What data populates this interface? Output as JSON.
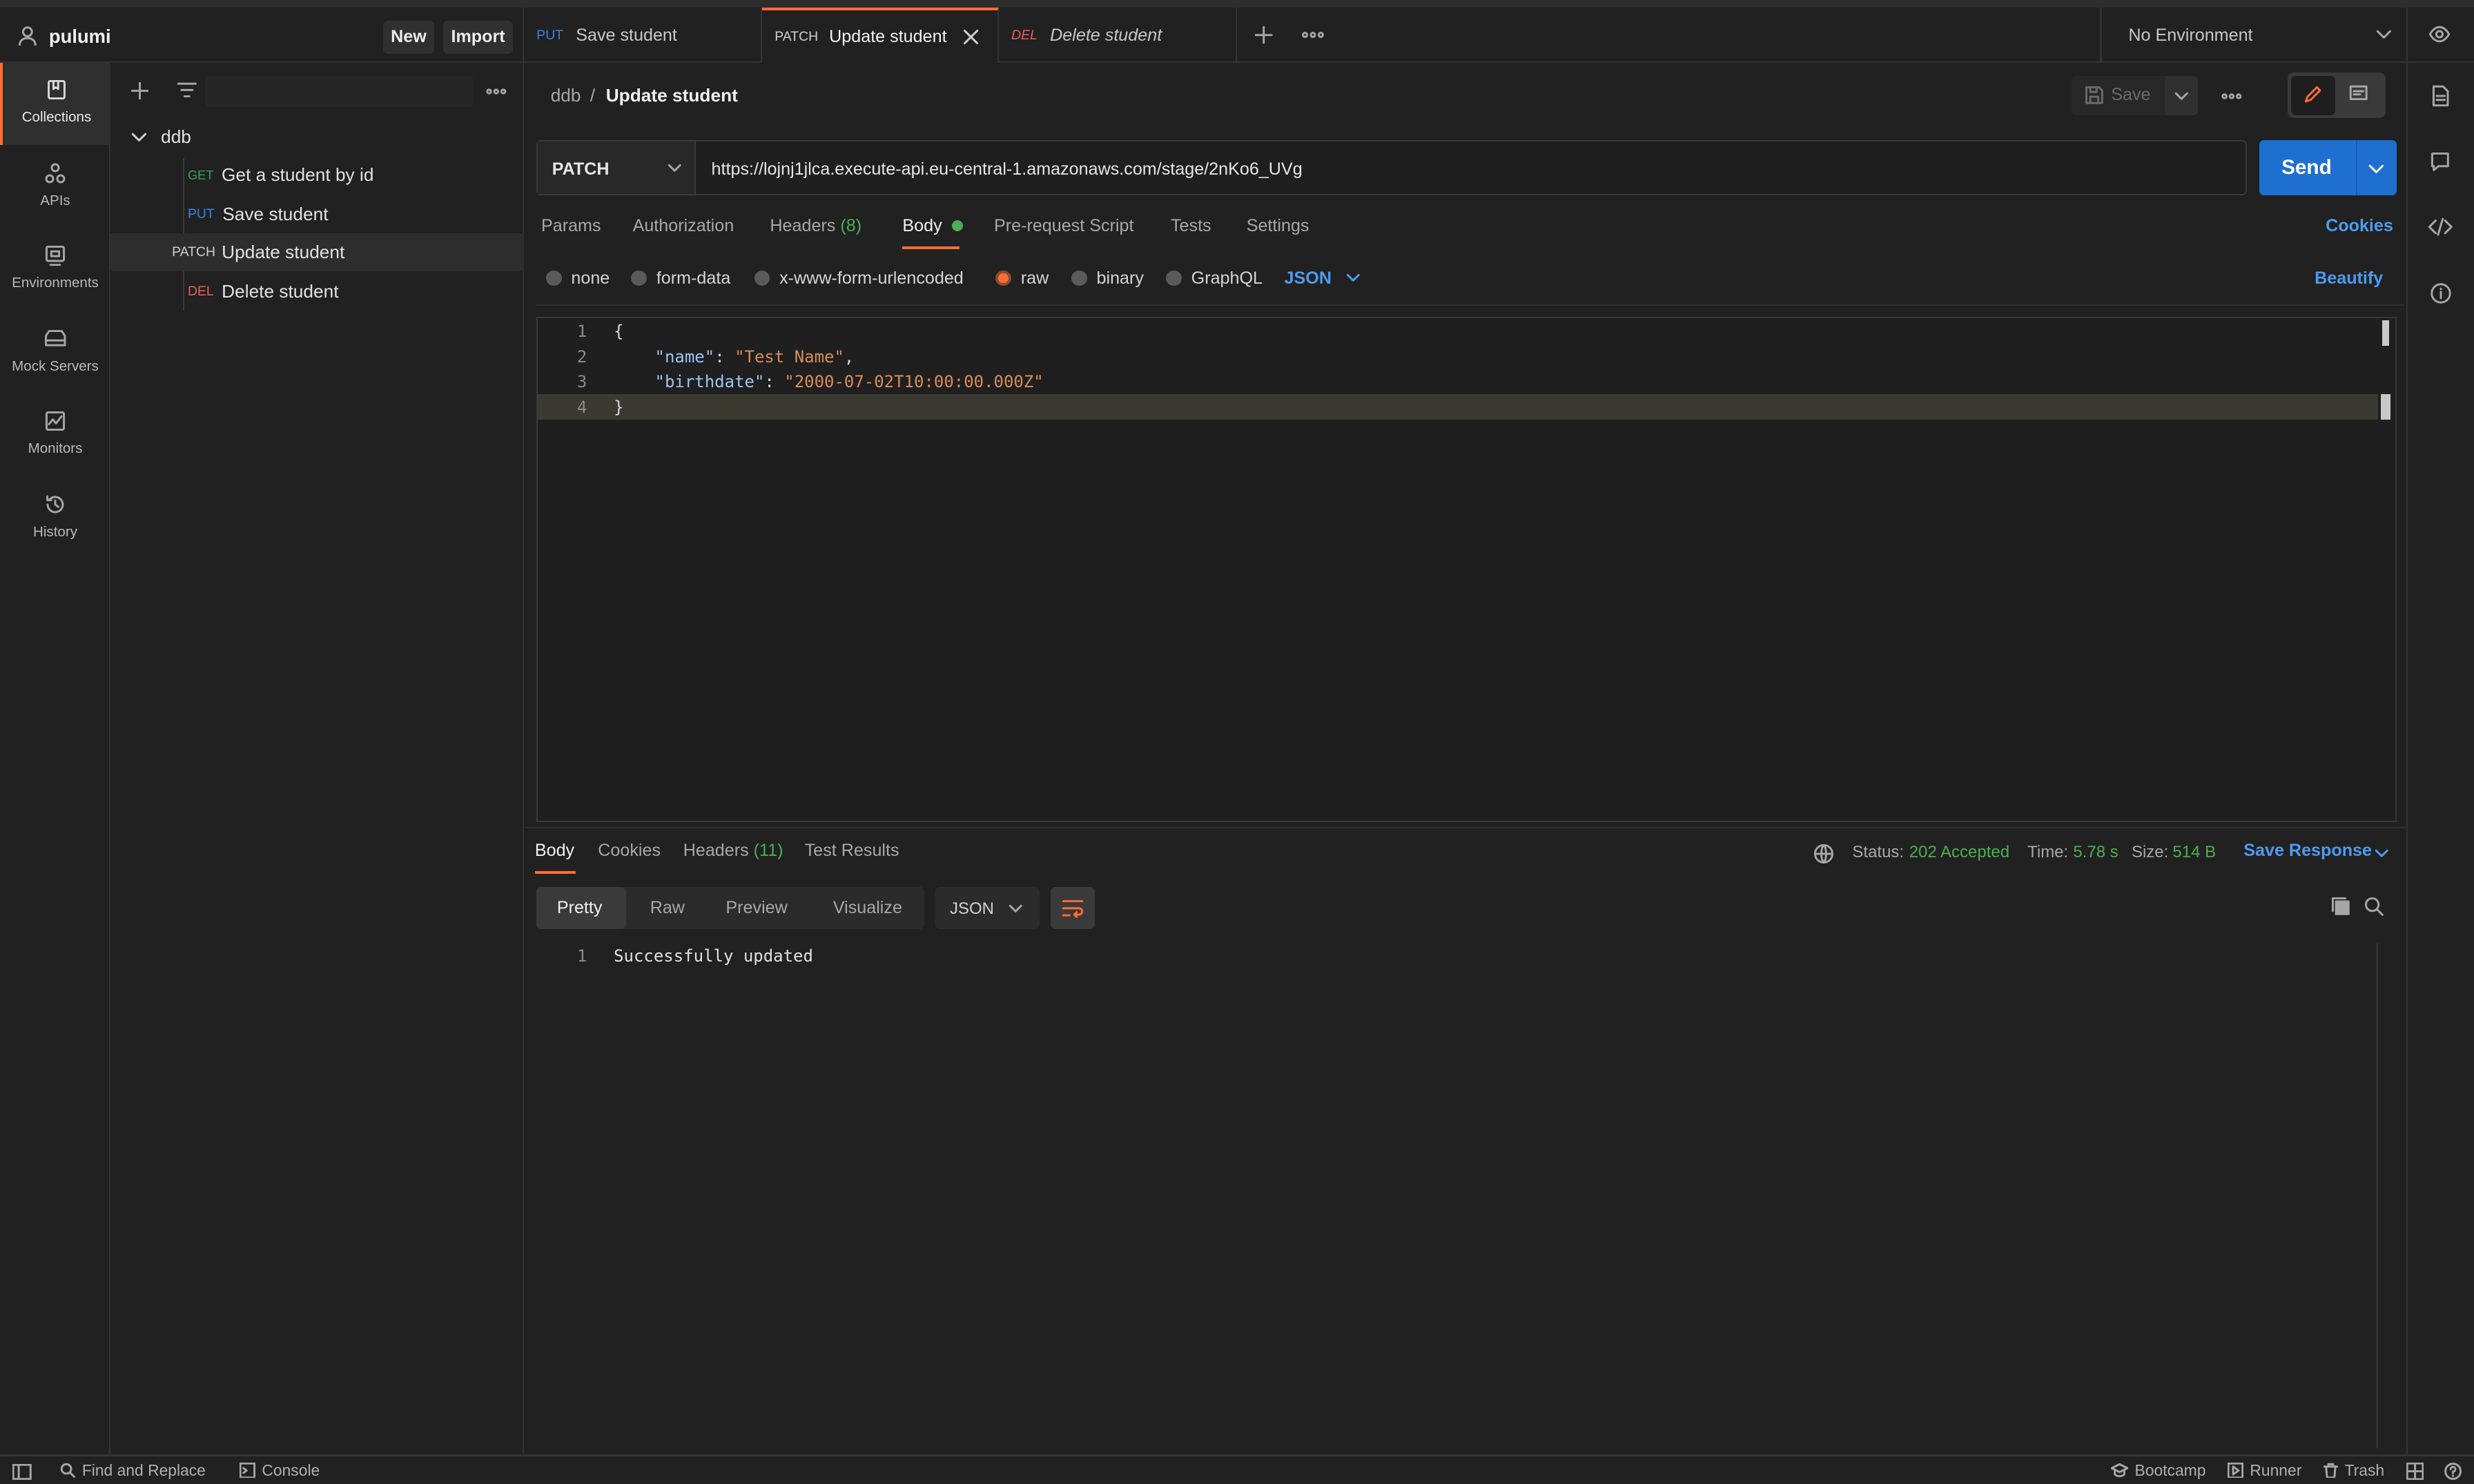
{
  "workspace": {
    "name": "pulumi",
    "new_label": "New",
    "import_label": "Import"
  },
  "tabs": [
    {
      "method": "PUT",
      "label": "Save student"
    },
    {
      "method": "PATCH",
      "label": "Update student"
    },
    {
      "method": "DEL",
      "label": "Delete student"
    }
  ],
  "environment": {
    "selected": "No Environment"
  },
  "leftnav": [
    {
      "label": "Collections",
      "icon": "collections-icon"
    },
    {
      "label": "APIs",
      "icon": "apis-icon"
    },
    {
      "label": "Environments",
      "icon": "environments-icon"
    },
    {
      "label": "Mock Servers",
      "icon": "mock-servers-icon"
    },
    {
      "label": "Monitors",
      "icon": "monitors-icon"
    },
    {
      "label": "History",
      "icon": "history-icon"
    }
  ],
  "collection": {
    "name": "ddb",
    "requests": [
      {
        "method": "GET",
        "label": "Get a student by id"
      },
      {
        "method": "PUT",
        "label": "Save student"
      },
      {
        "method": "PATCH",
        "label": "Update student"
      },
      {
        "method": "DEL",
        "label": "Delete student"
      }
    ]
  },
  "breadcrumb": {
    "parent": "ddb",
    "separator": "/",
    "current": "Update student"
  },
  "toolbar": {
    "save_label": "Save"
  },
  "request": {
    "method": "PATCH",
    "url": "https://lojnj1jlca.execute-api.eu-central-1.amazonaws.com/stage/2nKo6_UVg",
    "send_label": "Send"
  },
  "request_tabs": {
    "params": "Params",
    "authorization": "Authorization",
    "headers": "Headers",
    "headers_count": "(8)",
    "body": "Body",
    "prerequest": "Pre-request Script",
    "tests": "Tests",
    "settings": "Settings",
    "cookies": "Cookies"
  },
  "body_options": {
    "none": "none",
    "form_data": "form-data",
    "urlencoded": "x-www-form-urlencoded",
    "raw": "raw",
    "binary": "binary",
    "graphql": "GraphQL",
    "format": "JSON",
    "beautify": "Beautify"
  },
  "code": {
    "line_numbers": [
      "1",
      "2",
      "3",
      "4"
    ],
    "open_brace": "{",
    "close_brace": "}",
    "line2_key": "\"name\"",
    "line2_value": "\"Test Name\"",
    "line3_key": "\"birthdate\"",
    "line3_value": "\"2000-07-02T10:00:00.000Z\""
  },
  "response": {
    "tabs": {
      "body": "Body",
      "cookies": "Cookies",
      "headers": "Headers",
      "headers_count": "(11)",
      "test_results": "Test Results"
    },
    "status_label": "Status:",
    "status_value": "202 Accepted",
    "time_label": "Time:",
    "time_value": "5.78 s",
    "size_label": "Size:",
    "size_value": "514 B",
    "save_response": "Save Response",
    "views": {
      "pretty": "Pretty",
      "raw": "Raw",
      "preview": "Preview",
      "visualize": "Visualize"
    },
    "format": "JSON",
    "line_number": "1",
    "body_text": "Successfully updated"
  },
  "statusbar": {
    "find_replace": "Find and Replace",
    "console": "Console",
    "bootcamp": "Bootcamp",
    "runner": "Runner",
    "trash": "Trash"
  },
  "colors": {
    "accent": "#ff6c37",
    "send": "#1f6fd1",
    "status_ok": "#4caf50",
    "link": "#4d9bf0"
  }
}
